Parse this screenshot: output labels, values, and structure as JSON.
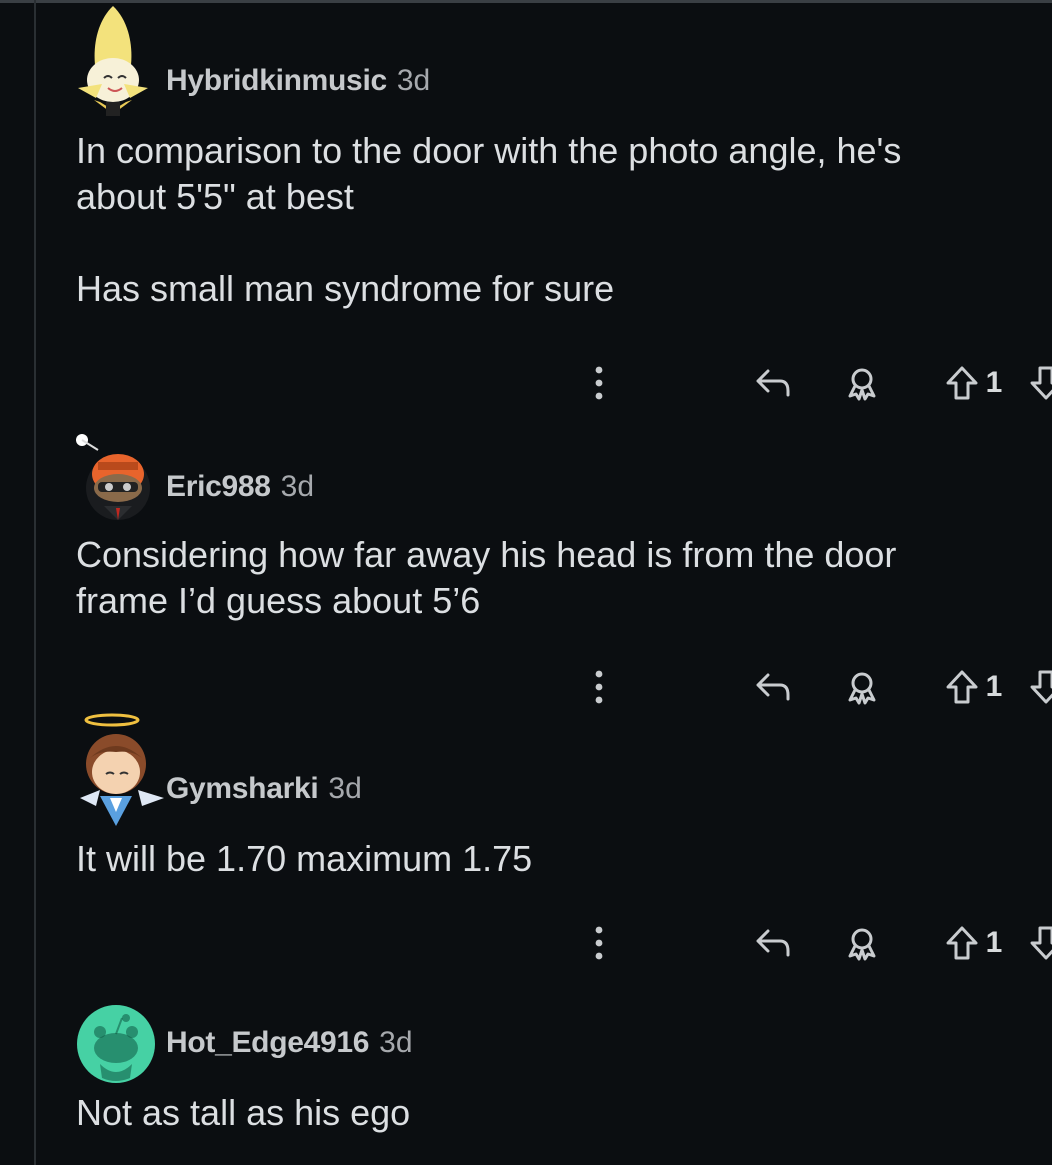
{
  "comments": [
    {
      "username": "Hybridkinmusic",
      "age": "3d",
      "avatar": "banana-avatar-icon",
      "body": "In comparison to the door with the photo angle, he's\nabout 5'5\" at best\n\nHas small man syndrome for sure",
      "score": "1"
    },
    {
      "username": "Eric988",
      "age": "3d",
      "avatar": "snoo-orange-helmet-avatar-icon",
      "body": "Considering how far away his head is from the door\nframe I’d guess about 5’6",
      "score": "1"
    },
    {
      "username": "Gymsharki",
      "age": "3d",
      "avatar": "angel-boy-avatar-icon",
      "body": "It will be 1.70 maximum 1.75",
      "score": "1"
    },
    {
      "username": "Hot_Edge4916",
      "age": "3d",
      "avatar": "default-snoo-avatar-icon",
      "body": "Not as tall as his ego"
    }
  ],
  "colors": {
    "background": "#0b0e11",
    "text": "#dcdfe2",
    "muted": "#a6a9ad",
    "default_avatar_bg": "#46d1a4"
  }
}
